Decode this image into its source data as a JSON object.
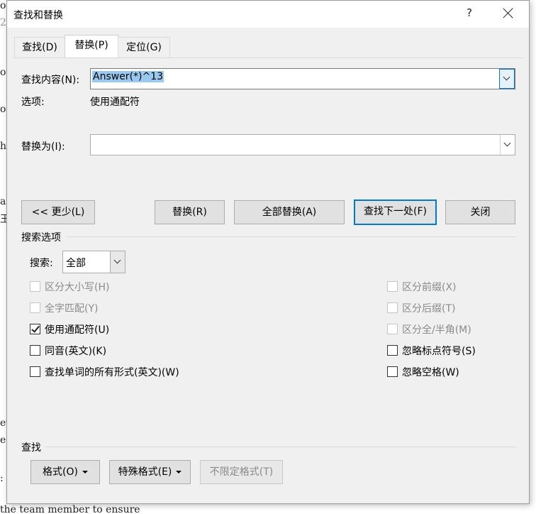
{
  "background": {
    "fragments": [
      "o",
      "2",
      "ot",
      "o",
      "he",
      "ar",
      "王",
      "ev",
      "e",
      ": -"
    ],
    "bottom_text": "the team member to ensure"
  },
  "dialog": {
    "title": "查找和替换",
    "help_icon": "?",
    "tabs": [
      {
        "label": "查找(D)",
        "active": false
      },
      {
        "label": "替换(P)",
        "active": true
      },
      {
        "label": "定位(G)",
        "active": false
      }
    ],
    "find": {
      "label": "查找内容(N):",
      "value": "Answer(*)^13",
      "options_label": "选项:",
      "options_value": "使用通配符"
    },
    "replace": {
      "label": "替换为(I):",
      "value": ""
    },
    "buttons": {
      "less": "<< 更少(L)",
      "replace": "替换(R)",
      "replace_all": "全部替换(A)",
      "find_next": "查找下一处(F)",
      "close": "关闭"
    },
    "search_options": {
      "heading": "搜索选项",
      "search_label": "搜索:",
      "search_value": "全部",
      "left_checks": [
        {
          "label": "区分大小写(H)",
          "checked": false,
          "enabled": false
        },
        {
          "label": "全字匹配(Y)",
          "checked": false,
          "enabled": false
        },
        {
          "label": "使用通配符(U)",
          "checked": true,
          "enabled": true
        },
        {
          "label": "同音(英文)(K)",
          "checked": false,
          "enabled": true
        },
        {
          "label": "查找单词的所有形式(英文)(W)",
          "checked": false,
          "enabled": true
        }
      ],
      "right_checks": [
        {
          "label": "区分前缀(X)",
          "checked": false,
          "enabled": false
        },
        {
          "label": "区分后缀(T)",
          "checked": false,
          "enabled": false
        },
        {
          "label": "区分全/半角(M)",
          "checked": false,
          "enabled": false
        },
        {
          "label": "忽略标点符号(S)",
          "checked": false,
          "enabled": true
        },
        {
          "label": "忽略空格(W)",
          "checked": false,
          "enabled": true
        }
      ]
    },
    "find_section": {
      "heading": "查找",
      "format_button": "格式(O)",
      "special_button": "特殊格式(E)",
      "no_format_button": "不限定格式(T)"
    },
    "accent_color": "#0078d7",
    "selection_color": "#99c9ef"
  }
}
